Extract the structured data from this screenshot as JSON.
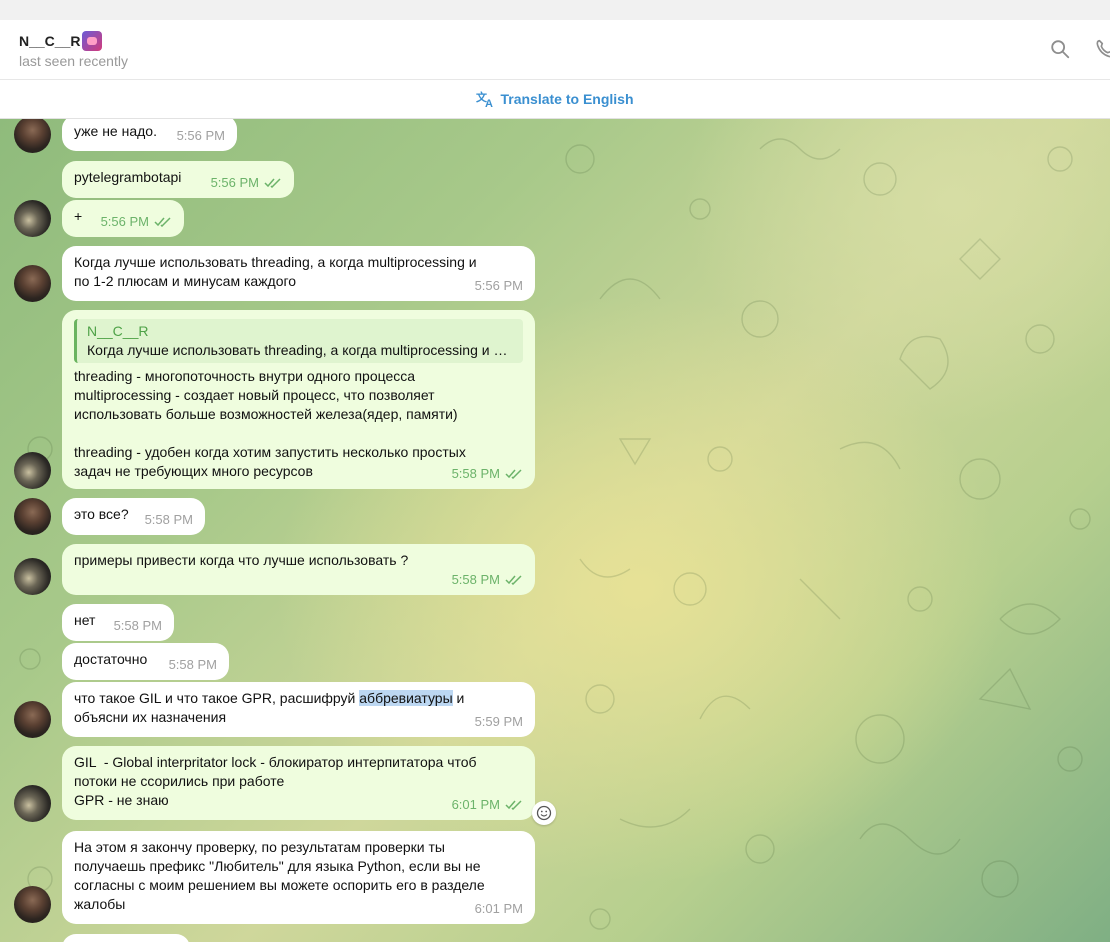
{
  "chat": {
    "name": "N__C__R",
    "status": "last seen recently"
  },
  "translate": {
    "label": "Translate to English"
  },
  "messages": [
    {
      "dir": "in",
      "text": "уже не надо.",
      "time": "5:56 PM"
    },
    {
      "dir": "out",
      "text": "pytelegrambotapi",
      "time": "5:56 PM"
    },
    {
      "dir": "out",
      "text": "+",
      "time": "5:56 PM"
    },
    {
      "dir": "in",
      "text": "Когда лучше использовать threading, а когда multiprocessing и\nпо 1-2 плюсам и минусам каждого",
      "time": "5:56 PM"
    },
    {
      "dir": "out",
      "reply_name": "N__C__R",
      "reply_text": "Когда лучше использовать threading, а когда multiprocessing и по 1-2 плюсам и минусам каждого",
      "text": "threading - многопоточность внутри одного процесса\nmultiprocessing - создает новый процесс, что позволяет\nиспользовать больше возможностей железа(ядер, памяти)\n\nthreading - удобен когда хотим запустить несколько простых\nзадач не требующих много ресурсов",
      "time": "5:58 PM"
    },
    {
      "dir": "in",
      "text": "это все?",
      "time": "5:58 PM"
    },
    {
      "dir": "out",
      "text": "примеры привести когда что лучше использовать ?",
      "time": "5:58 PM"
    },
    {
      "dir": "in",
      "text": "нет",
      "time": "5:58 PM"
    },
    {
      "dir": "in",
      "text": "достаточно",
      "time": "5:58 PM"
    },
    {
      "dir": "in",
      "text_a": "что такое GIL и что такое GPR, расшифруй ",
      "text_hl": "аббревиатуры",
      "text_b": " и\nобъясни их назначения",
      "time": "5:59 PM"
    },
    {
      "dir": "out",
      "text": "GIL  - Global interpritator lock - блокиратор интерпитатора чтоб\nпотоки не ссорились при работе\nGPR - не знаю",
      "time": "6:01 PM"
    },
    {
      "dir": "in",
      "text": "На этом я закончу проверку, по результатам проверки ты\nполучаешь префикс \"Любитель\" для языка Python, если вы не\nсогласны с моим решением вы можете оспорить его в разделе\nжалобы",
      "time": "6:01 PM"
    }
  ]
}
